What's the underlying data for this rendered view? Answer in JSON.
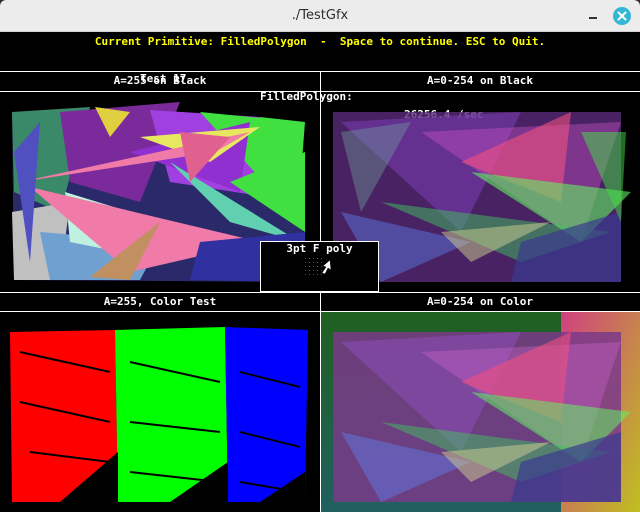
{
  "window": {
    "title": "./TestGfx"
  },
  "status_line": "Current Primitive: FilledPolygon  -  Space to continue. ESC to Quit.",
  "perf": {
    "test": "Test 17",
    "primitive": "FilledPolygon:",
    "rate": "26256.4 /sec"
  },
  "quadrants": {
    "top_left": "A=255 on Black",
    "top_right": "A=0-254 on Black",
    "bottom_left": "A=255, Color Test",
    "bottom_right": "A=0-254 on Color"
  },
  "probe": {
    "label": "3pt F poly"
  },
  "colors": {
    "status": "#ffff00",
    "text": "#ffffff",
    "close_button": "#35b6d6",
    "titlebar": "#ececec"
  },
  "icons": [
    "minimize-icon",
    "close-icon",
    "mouse-cursor-icon"
  ]
}
